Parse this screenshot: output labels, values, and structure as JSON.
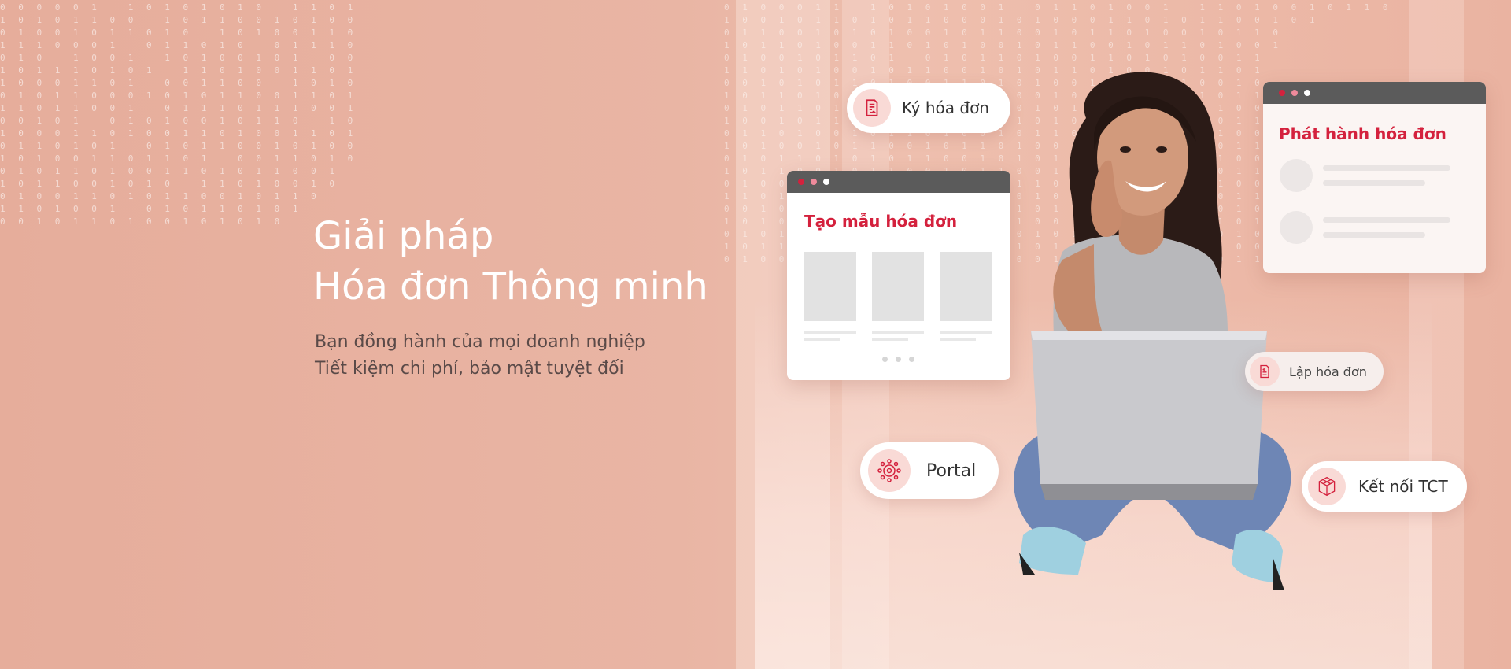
{
  "hero": {
    "title_line1": "Giải pháp",
    "title_line2": "Hóa đơn Thông minh",
    "subtitle_line1": "Bạn đồng hành của mọi doanh nghiệp",
    "subtitle_line2": "Tiết kiệm chi phí, bảo mật tuyệt đối"
  },
  "features": {
    "sign_invoice": {
      "label": "Ký hóa đơn",
      "icon": "sign-document-icon"
    },
    "create_invoice": {
      "label": "Lập hóa đơn",
      "icon": "invoice-document-icon"
    },
    "portal": {
      "label": "Portal",
      "icon": "portal-network-icon"
    },
    "connect_tct": {
      "label": "Kết nối TCT",
      "icon": "cube-network-icon"
    }
  },
  "cards": {
    "template_card": {
      "title": "Tạo mẫu hóa đơn"
    },
    "publish_card": {
      "title": "Phát hành hóa đơn"
    }
  },
  "colors": {
    "accent": "#d4213d",
    "background": "#e8b4a3",
    "window_bar": "#5b5b5b",
    "icon_bg": "#f9dad6"
  }
}
